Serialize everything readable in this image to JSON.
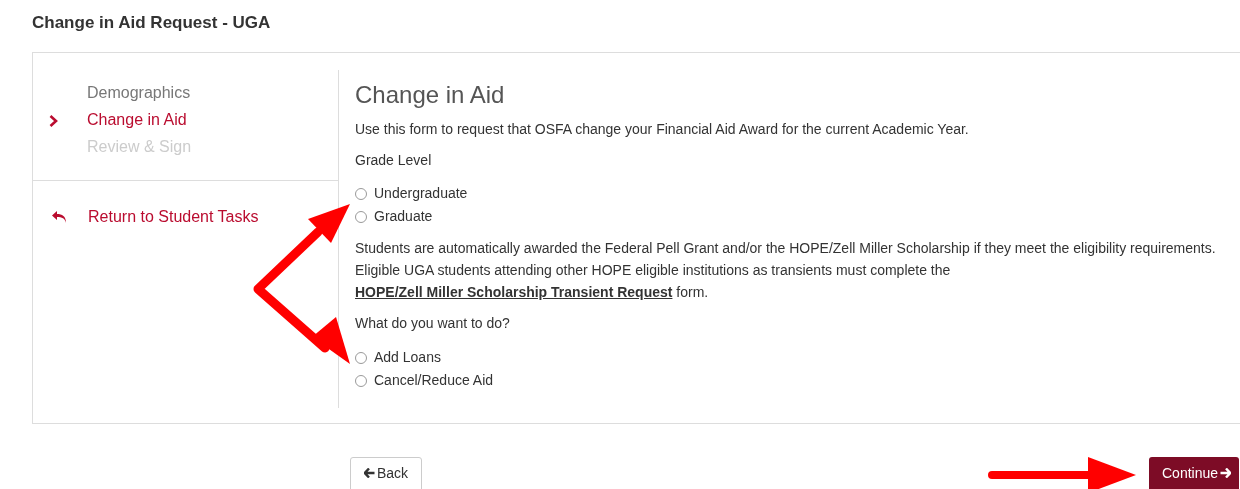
{
  "page_title": "Change in Aid Request - UGA",
  "steps": [
    {
      "label": "Demographics",
      "kind": "done"
    },
    {
      "label": "Change in Aid",
      "kind": "current"
    },
    {
      "label": "Review & Sign",
      "kind": "upcoming"
    }
  ],
  "return_link": "Return to Student Tasks",
  "form": {
    "heading": "Change in Aid",
    "intro": "Use this form to request that OSFA change your Financial Aid Award for the current Academic Year.",
    "grade_level": {
      "label": "Grade Level",
      "options": [
        {
          "label": "Undergraduate",
          "selected": false
        },
        {
          "label": "Graduate",
          "selected": false
        }
      ]
    },
    "notice": {
      "before": "Students are automatically awarded the Federal Pell Grant and/or the HOPE/Zell Miller Scholarship if they meet the eligibility requirements. Eligible UGA students attending other HOPE eligible institutions as transients must complete the ",
      "link": "HOPE/Zell Miller Scholarship Transient Request",
      "after": " form."
    },
    "action": {
      "label": "What do you want to do?",
      "options": [
        {
          "label": "Add Loans",
          "selected": false
        },
        {
          "label": "Cancel/Reduce Aid",
          "selected": false
        }
      ]
    }
  },
  "buttons": {
    "back": "Back",
    "continue": "Continue"
  }
}
